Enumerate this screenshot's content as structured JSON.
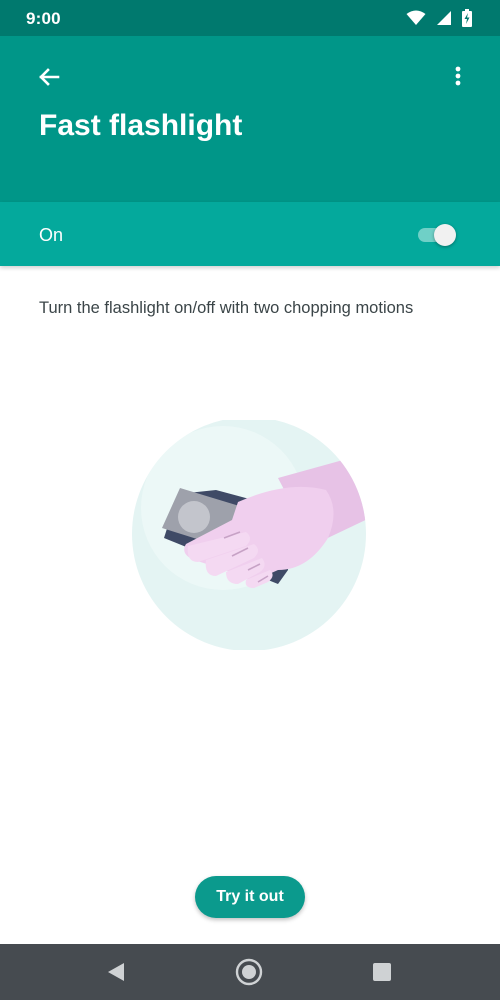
{
  "status_bar": {
    "time": "9:00",
    "icons": [
      "wifi-icon",
      "cell-signal-icon",
      "battery-charging-icon"
    ]
  },
  "app_bar": {
    "back_icon": "arrow-back-icon",
    "more_icon": "more-vert-icon",
    "title": "Fast flashlight"
  },
  "toggle": {
    "label": "On",
    "checked": true
  },
  "description": "Turn the flashlight on/off with two chopping motions",
  "illustration": {
    "name": "hand-holding-phone-illustration"
  },
  "actions": {
    "try_label": "Try it out"
  },
  "nav_bar": {
    "icons": [
      "back-triangle-icon",
      "home-circle-icon",
      "recents-square-icon"
    ]
  },
  "colors": {
    "status_bar": "#00796e",
    "app_bar": "#009688",
    "toggle_row": "#04a99c",
    "accent_button": "#0b9a8d",
    "nav_bar": "#464b50"
  }
}
